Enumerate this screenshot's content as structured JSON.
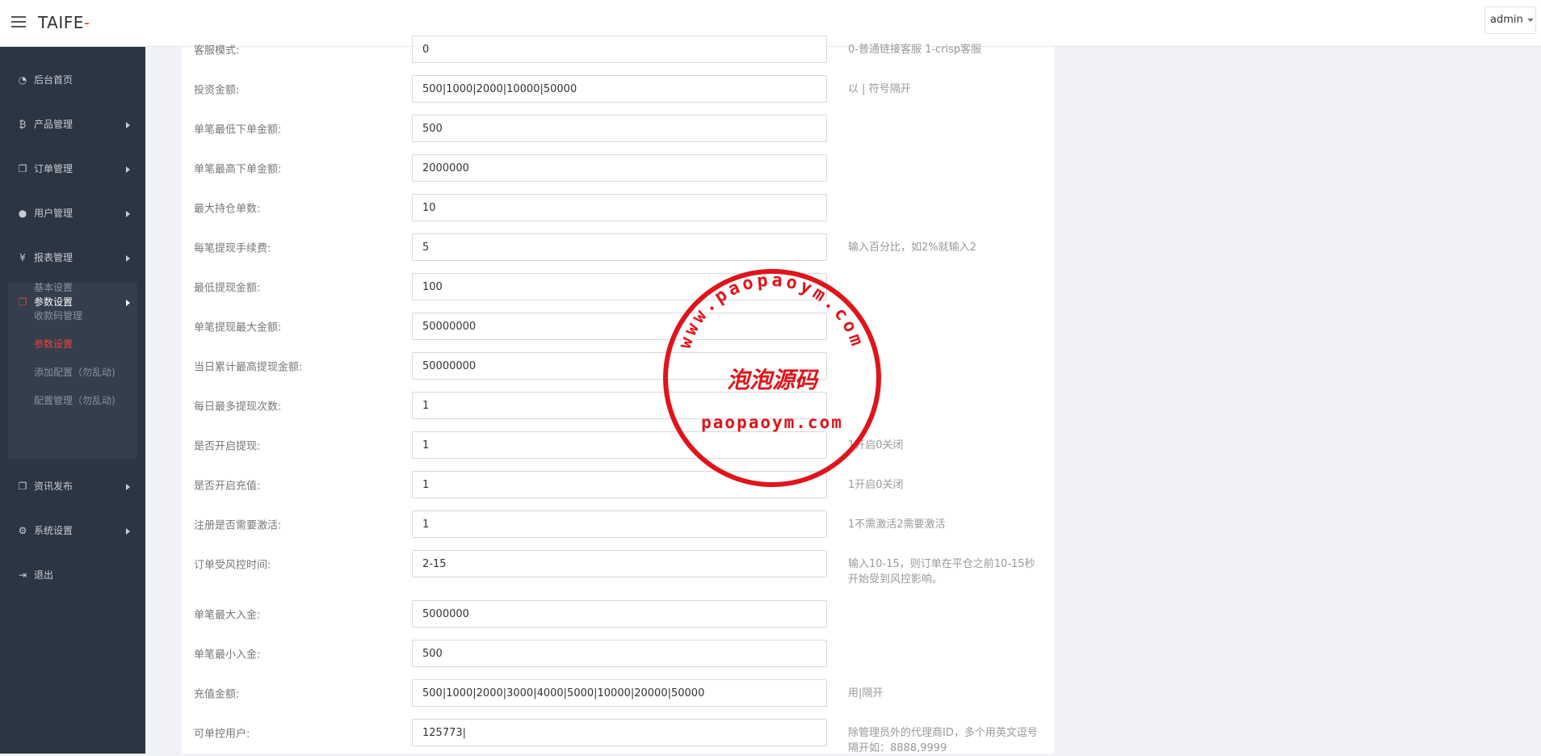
{
  "header": {
    "brand": "TAIFE",
    "brand_accent": "-",
    "user_label": "admin",
    "accent_color": "#e8443a"
  },
  "sidebar": {
    "items": [
      {
        "icon": "dashboard-icon",
        "glyph": "◔",
        "label": "后台首页",
        "has_arrow": false
      },
      {
        "icon": "bitcoin-icon",
        "glyph": "₿",
        "label": "产品管理",
        "has_arrow": true
      },
      {
        "icon": "copy-icon",
        "glyph": "❐",
        "label": "订单管理",
        "has_arrow": true
      },
      {
        "icon": "user-icon",
        "glyph": "●",
        "label": "用户管理",
        "has_arrow": true
      },
      {
        "icon": "yen-icon",
        "glyph": "¥",
        "label": "报表管理",
        "has_arrow": true
      },
      {
        "icon": "copy-icon",
        "glyph": "❐",
        "label": "参数设置",
        "has_arrow": true
      },
      {
        "icon": "copy-icon",
        "glyph": "❐",
        "label": "资讯发布",
        "has_arrow": true
      },
      {
        "icon": "gears-icon",
        "glyph": "⚙",
        "label": "系统设置",
        "has_arrow": true
      },
      {
        "icon": "sign-out-icon",
        "glyph": "⇥",
        "label": "退出",
        "has_arrow": false
      }
    ],
    "sub_items": [
      "基本设置",
      "收款码管理",
      "参数设置",
      "添加配置（勿乱动)",
      "配置管理（勿乱动)"
    ]
  },
  "form": {
    "rows": [
      {
        "label": "客服模式:",
        "value": "0",
        "hint": "0-普通链接客服 1-crisp客服"
      },
      {
        "label": "投资金额:",
        "value": "500|1000|2000|10000|50000",
        "hint": "以 | 符号隔开"
      },
      {
        "label": "单笔最低下单金额:",
        "value": "500",
        "hint": ""
      },
      {
        "label": "单笔最高下单金额:",
        "value": "2000000",
        "hint": ""
      },
      {
        "label": "最大持仓单数:",
        "value": "10",
        "hint": ""
      },
      {
        "label": "每笔提现手续费:",
        "value": "5",
        "hint": "输入百分比，如2%就输入2"
      },
      {
        "label": "最低提现金额:",
        "value": "100",
        "hint": ""
      },
      {
        "label": "单笔提现最大金额:",
        "value": "50000000",
        "hint": ""
      },
      {
        "label": "当日累计最高提现金额:",
        "value": "50000000",
        "hint": ""
      },
      {
        "label": "每日最多提现次数:",
        "value": "1",
        "hint": ""
      },
      {
        "label": "是否开启提现:",
        "value": "1",
        "hint": "1开启0关闭"
      },
      {
        "label": "是否开启充值:",
        "value": "1",
        "hint": "1开启0关闭"
      },
      {
        "label": "注册是否需要激活:",
        "value": "1",
        "hint": "1不需激活2需要激活"
      },
      {
        "label": "订单受风控时间:",
        "value": "2-15",
        "hint": "输入10-15，则订单在平仓之前10-15秒开始受到风控影响。"
      },
      {
        "label": "单笔最大入金:",
        "value": "5000000",
        "hint": ""
      },
      {
        "label": "单笔最小入金:",
        "value": "500",
        "hint": ""
      },
      {
        "label": "充值金额:",
        "value": "500|1000|2000|3000|4000|5000|10000|20000|50000",
        "hint": "用|隔开"
      },
      {
        "label": "可单控用户:",
        "value": "125773|",
        "hint": "除管理员外的代理商ID，多个用英文逗号隔开如：8888,9999"
      }
    ]
  },
  "watermark": {
    "ring_text": "www.paopaoym.com",
    "center_text": "泡泡源码",
    "bottom_text": "paopaoym.com",
    "color": "#e0141b"
  }
}
